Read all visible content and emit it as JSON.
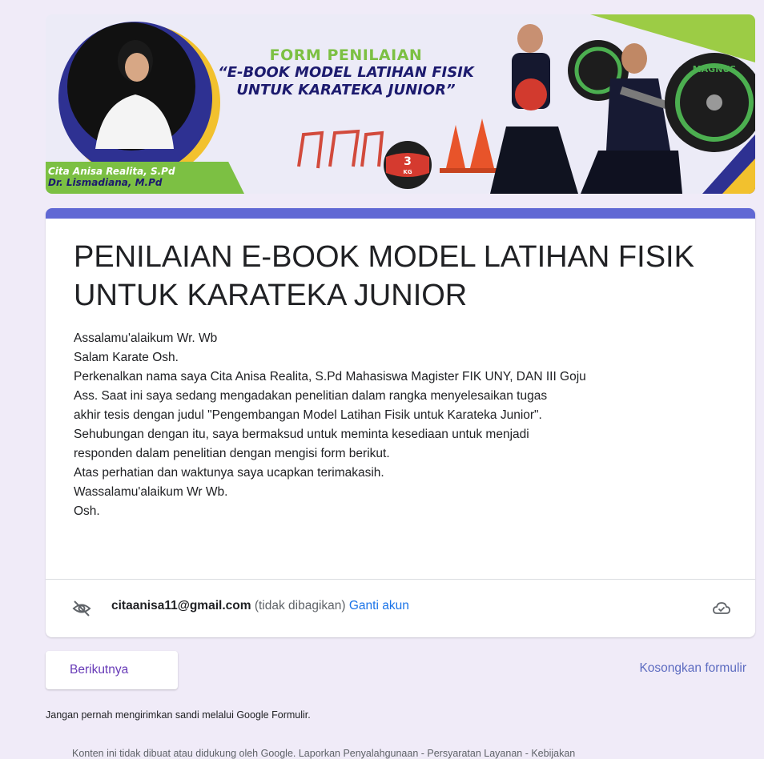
{
  "banner": {
    "title_line1": "FORM PENILAIAN",
    "title_line2": "“E-BOOK MODEL LATIHAN FISIK",
    "title_line3": "UNTUK KARATEKA JUNIOR”",
    "author1": "Cita Anisa Realita, S.Pd",
    "author2": "Dr. Lismadiana, M.Pd",
    "ball_label": "3",
    "ball_unit": "KG",
    "plate_brand": "MAGNUS"
  },
  "form": {
    "title": "PENILAIAN E-BOOK MODEL LATIHAN FISIK UNTUK KARATEKA JUNIOR",
    "description_lines": [
      "Assalamu'alaikum Wr. Wb",
      "Salam Karate Osh.",
      "Perkenalkan nama saya Cita Anisa Realita, S.Pd Mahasiswa Magister FIK UNY, DAN III Goju",
      "Ass. Saat ini saya sedang mengadakan penelitian dalam rangka menyelesaikan tugas",
      "akhir tesis dengan judul \"Pengembangan Model Latihan Fisik untuk Karateka Junior\".",
      "Sehubungan dengan itu, saya bermaksud untuk meminta kesediaan untuk menjadi",
      "responden dalam penelitian dengan mengisi form berikut.",
      "Atas perhatian dan waktunya saya ucapkan terimakasih.",
      "Wassalamu'alaikum Wr Wb.",
      "Osh."
    ]
  },
  "account": {
    "email": "citaanisa11@gmail.com",
    "not_shared": " (tidak dibagikan) ",
    "switch_account": "Ganti akun",
    "icons": {
      "privacy": "eye-off-icon",
      "save": "cloud-check-icon"
    }
  },
  "footer": {
    "next_label": "Berikutnya",
    "clear_label": "Kosongkan formulir",
    "warning": "Jangan pernah mengirimkan sandi melalui Google Formulir.",
    "disclaimer": "Konten ini tidak dibuat atau didukung oleh Google. Laporkan Penyalahgunaan - Persyaratan Layanan - Kebijakan"
  },
  "colors": {
    "page_bg": "#f0ebf8",
    "accent": "#6068d4",
    "button_text": "#673ab7",
    "link": "#1a73e8",
    "banner_green": "#7cc043",
    "banner_navy": "#1c1a6e"
  }
}
